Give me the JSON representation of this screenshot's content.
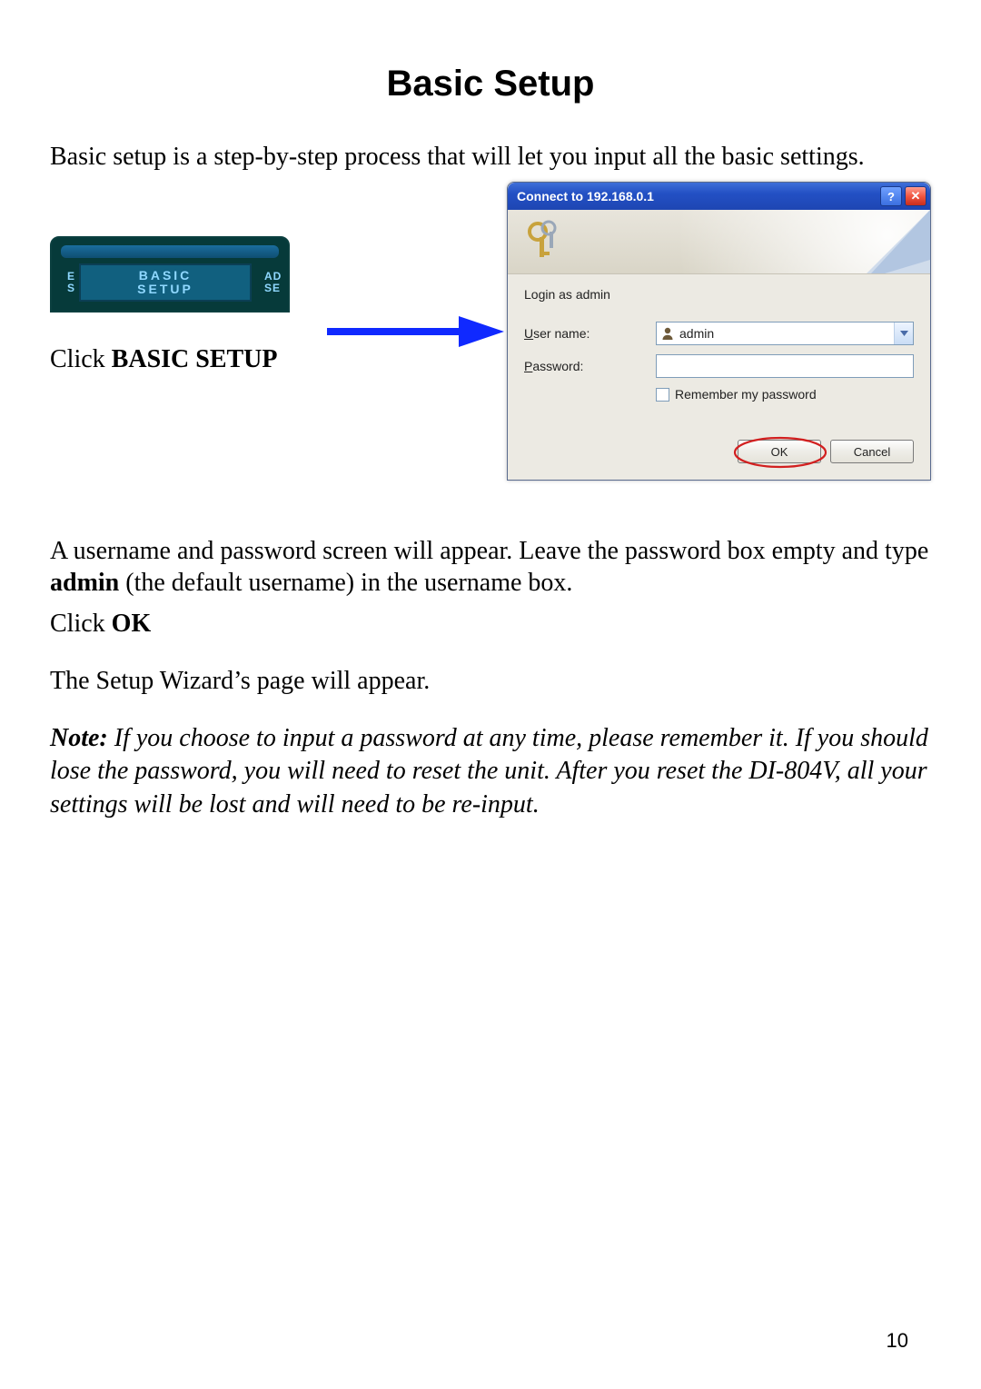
{
  "title": "Basic Setup",
  "intro": "Basic setup is a step-by-step process that will let you input all the basic settings.",
  "tab": {
    "line1": "BASIC",
    "line2": "SETUP",
    "left1": "E",
    "left2": "S",
    "right1": "AD",
    "right2": "SE"
  },
  "click_caption_prefix": "Click ",
  "click_caption_bold": "BASIC SETUP",
  "dialog": {
    "title": "Connect to 192.168.0.1",
    "help_glyph": "?",
    "close_glyph": "✕",
    "prompt": "Login as admin",
    "username_label_u": "U",
    "username_label_rest": "ser name:",
    "username_value": "admin",
    "password_label_u": "P",
    "password_label_rest": "assword:",
    "remember_u": "R",
    "remember_rest": "emember my password",
    "ok": "OK",
    "cancel": "Cancel"
  },
  "para2_a": "A username and password screen will appear. Leave the password box empty and type ",
  "para2_bold": "admin",
  "para2_b": "  (the default username) in the username box.",
  "para2_click_prefix": "Click ",
  "para2_click_bold": "OK",
  "para3": "The Setup Wizard’s page will appear.",
  "note_label": "Note:",
  "note_body": "  If you choose to input a password at any time, please remember it. If you should lose the password, you will need to reset the unit.  After you reset the DI-804V, all your settings will be lost and will need to be re-input.",
  "page_number": "10"
}
